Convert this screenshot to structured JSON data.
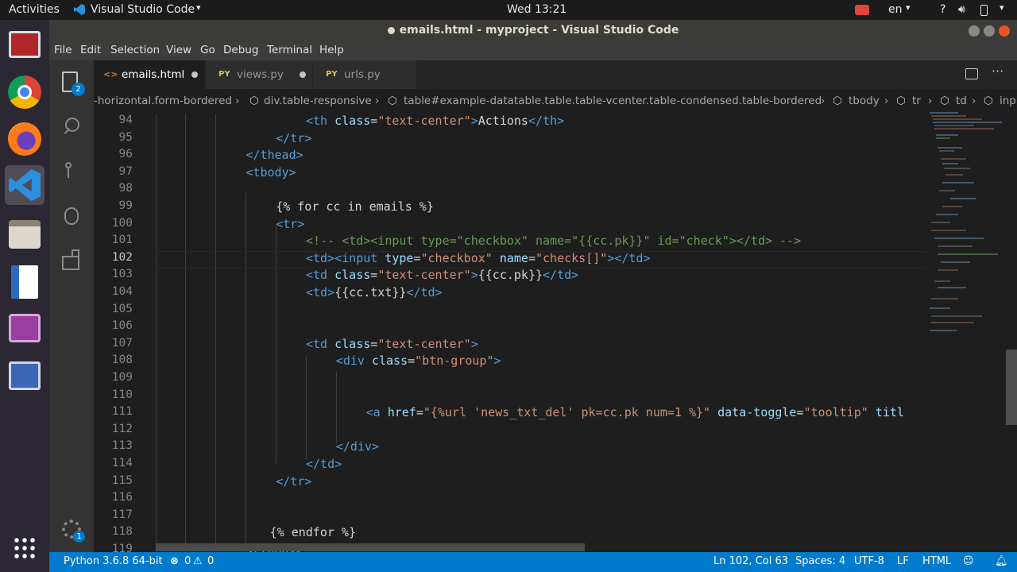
{
  "topbar": {
    "activities": "Activities",
    "app_menu": "Visual Studio Code",
    "clock": "Wed 13:21",
    "lang": "en"
  },
  "window": {
    "title": "emails.html - myproject - Visual Studio Code"
  },
  "menu": [
    "File",
    "Edit",
    "Selection",
    "View",
    "Go",
    "Debug",
    "Terminal",
    "Help"
  ],
  "activity": {
    "explorer_badge": "2",
    "settings_badge": "1"
  },
  "tabs": [
    {
      "label": "emails.html",
      "prefix": "<>",
      "active": true
    },
    {
      "label": "views.py",
      "prefix": "PY",
      "active": false
    },
    {
      "label": "urls.py",
      "prefix": "PY",
      "active": false
    }
  ],
  "breadcrumb": [
    "-horizontal.form-bordered",
    "div.table-responsive",
    "table#example-datatable.table.table-vcenter.table-condensed.table-bordered",
    "tbody",
    "tr",
    "td",
    "inp"
  ],
  "editor": {
    "current_line": "102",
    "lines": [
      {
        "n": "94",
        "indent": 5,
        "segs": [
          [
            "tag",
            "<th "
          ],
          [
            "attr",
            "class"
          ],
          [
            "",
            "="
          ],
          [
            "str",
            "\"text-center\""
          ],
          [
            "tag",
            ">"
          ],
          [
            "",
            "Actions"
          ],
          [
            "tag",
            "</th>"
          ]
        ]
      },
      {
        "n": "95",
        "indent": 4,
        "segs": [
          [
            "tag",
            "</tr>"
          ]
        ]
      },
      {
        "n": "96",
        "indent": 3,
        "segs": [
          [
            "tag",
            "</thead>"
          ]
        ]
      },
      {
        "n": "97",
        "indent": 3,
        "segs": [
          [
            "tag",
            "<tbody>"
          ]
        ]
      },
      {
        "n": "98",
        "indent": 0,
        "segs": []
      },
      {
        "n": "99",
        "indent": 4,
        "segs": [
          [
            "",
            "{% for cc in emails %}"
          ]
        ]
      },
      {
        "n": "100",
        "indent": 4,
        "segs": [
          [
            "tag",
            "<tr>"
          ]
        ]
      },
      {
        "n": "101",
        "indent": 5,
        "segs": [
          [
            "cmt",
            "<!-- <td><input type=\"checkbox\" name=\"{{cc.pk}}\" id=\"check\"></td> -->"
          ]
        ]
      },
      {
        "n": "102",
        "indent": 5,
        "segs": [
          [
            "tag",
            "<td><input "
          ],
          [
            "attr",
            "type"
          ],
          [
            "",
            "="
          ],
          [
            "str",
            "\"checkbox\""
          ],
          [
            "",
            " "
          ],
          [
            "attr",
            "name"
          ],
          [
            "",
            "="
          ],
          [
            "str",
            "\"checks[]\""
          ],
          [
            "tag",
            "></td>"
          ]
        ]
      },
      {
        "n": "103",
        "indent": 5,
        "segs": [
          [
            "tag",
            "<td "
          ],
          [
            "attr",
            "class"
          ],
          [
            "",
            "="
          ],
          [
            "str",
            "\"text-center\""
          ],
          [
            "tag",
            ">"
          ],
          [
            "",
            "{{cc.pk}}"
          ],
          [
            "tag",
            "</td>"
          ]
        ]
      },
      {
        "n": "104",
        "indent": 5,
        "segs": [
          [
            "tag",
            "<td>"
          ],
          [
            "",
            "{{cc.txt}}"
          ],
          [
            "tag",
            "</td>"
          ]
        ]
      },
      {
        "n": "105",
        "indent": 0,
        "segs": []
      },
      {
        "n": "106",
        "indent": 0,
        "segs": []
      },
      {
        "n": "107",
        "indent": 5,
        "segs": [
          [
            "tag",
            "<td "
          ],
          [
            "attr",
            "class"
          ],
          [
            "",
            "="
          ],
          [
            "str",
            "\"text-center\""
          ],
          [
            "tag",
            ">"
          ]
        ]
      },
      {
        "n": "108",
        "indent": 6,
        "segs": [
          [
            "tag",
            "<div "
          ],
          [
            "attr",
            "class"
          ],
          [
            "",
            "="
          ],
          [
            "str",
            "\"btn-group\""
          ],
          [
            "tag",
            ">"
          ]
        ]
      },
      {
        "n": "109",
        "indent": 0,
        "segs": []
      },
      {
        "n": "110",
        "indent": 0,
        "segs": []
      },
      {
        "n": "111",
        "indent": 7,
        "segs": [
          [
            "tag",
            "<a "
          ],
          [
            "attr",
            "href"
          ],
          [
            "",
            "="
          ],
          [
            "str",
            "\"{%url 'news_txt_del' pk=cc.pk num=1 %}\""
          ],
          [
            "",
            " "
          ],
          [
            "attr",
            "data-toggle"
          ],
          [
            "",
            "="
          ],
          [
            "str",
            "\"tooltip\""
          ],
          [
            "",
            " "
          ],
          [
            "attr",
            "titl"
          ]
        ]
      },
      {
        "n": "112",
        "indent": 0,
        "segs": []
      },
      {
        "n": "113",
        "indent": 6,
        "segs": [
          [
            "tag",
            "</div>"
          ]
        ]
      },
      {
        "n": "114",
        "indent": 5,
        "segs": [
          [
            "tag",
            "</td>"
          ]
        ]
      },
      {
        "n": "115",
        "indent": 4,
        "segs": [
          [
            "tag",
            "</tr>"
          ]
        ]
      },
      {
        "n": "116",
        "indent": 0,
        "segs": []
      },
      {
        "n": "117",
        "indent": 0,
        "segs": []
      },
      {
        "n": "118",
        "indent": 3.8,
        "segs": [
          [
            "",
            "{% endfor %}"
          ]
        ]
      },
      {
        "n": "119",
        "indent": 3,
        "segs": [
          [
            "tag",
            "</tbody>"
          ]
        ]
      }
    ]
  },
  "status": {
    "python": "Python 3.6.8 64-bit",
    "errors": "0",
    "warnings": "0",
    "position": "Ln 102, Col 63",
    "spaces": "Spaces: 4",
    "encoding": "UTF-8",
    "eol": "LF",
    "language": "HTML"
  },
  "colors": {
    "statusbar": "#007acc",
    "editor_bg": "#1e1e1e",
    "tag": "#569cd6",
    "attr": "#9cdcfe",
    "string": "#ce9178",
    "comment": "#6a9955"
  }
}
